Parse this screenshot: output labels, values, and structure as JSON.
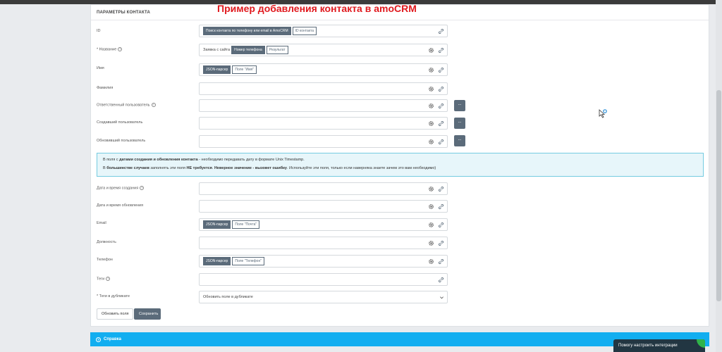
{
  "overlay_title": "Пример добавления контакта в amoCRM",
  "panel_title": "ПАРАМЕТРЫ КОНТАКТА",
  "fields": {
    "id": {
      "label": "ID",
      "chip1": "Поиск контакта по телефону или email в AmoCRM",
      "chip2": "ID контакта"
    },
    "name": {
      "label": "* Название",
      "text": "Заявка с сайта",
      "chip1": "Номер телефона",
      "chip2": "Результат"
    },
    "first_name": {
      "label": "Имя",
      "chip1": "JSON-парсер",
      "chip2": "Поле \"Имя\""
    },
    "last_name": {
      "label": "Фамилия"
    },
    "responsible": {
      "label": "Ответственный пользователь",
      "dots": "..."
    },
    "creator": {
      "label": "Создавший пользователь",
      "dots": "..."
    },
    "updater": {
      "label": "Обновивший пользователь",
      "dots": "..."
    },
    "created_at": {
      "label": "Дата и время создания"
    },
    "updated_at": {
      "label": "Дата и время обновления"
    },
    "email": {
      "label": "Email",
      "chip1": "JSON-парсер",
      "chip2": "Поле \"Почта\""
    },
    "position": {
      "label": "Должность"
    },
    "phone": {
      "label": "Телефон",
      "chip1": "JSON-парсер",
      "chip2": "Поле \"Телефон\""
    },
    "tags": {
      "label": "Теги"
    },
    "dup_tags": {
      "label": "* Теги в дубликате",
      "value": "Обновить поле в дубликате"
    }
  },
  "notice": {
    "l1_a": "В поля с ",
    "l1_b": "датами создания и обновления контакта",
    "l1_c": " - необходимо передавать дату в формате Unix Timestamp.",
    "l2_a": "В ",
    "l2_b": "большинстве случаев",
    "l2_c": " заполнять эти поля ",
    "l2_d": "НЕ требуется",
    "l2_e": ". ",
    "l2_f": "Неверное значение - вызовет ошибку",
    "l2_g": ". Используйте эти поля, только если наверняка знаете зачем это вам необходимо)"
  },
  "buttons": {
    "update": "Обновить поля",
    "save": "Сохранить"
  },
  "help": {
    "label": "Справка"
  },
  "chat": {
    "label": "Помогу настроить интеграции"
  }
}
